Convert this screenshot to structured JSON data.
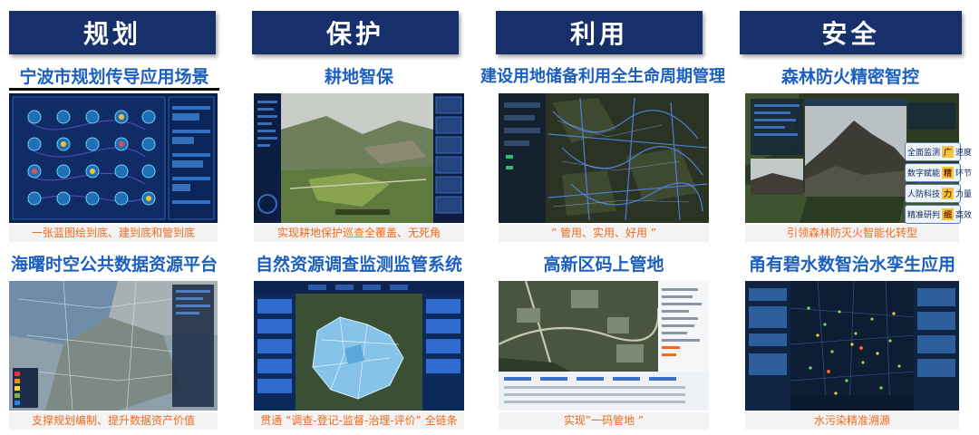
{
  "categories": [
    {
      "label": "规划"
    },
    {
      "label": "保护"
    },
    {
      "label": "利用"
    },
    {
      "label": "安全"
    }
  ],
  "cards": [
    {
      "title": "宁波市规划传导应用场景",
      "caption": "一张蓝图绘到底、建到底和管到底",
      "shot": "planning-dashboard"
    },
    {
      "title": "耕地智保",
      "caption": "实现耕地保护巡查全覆盖、无死角",
      "shot": "farmland-monitoring"
    },
    {
      "title": "建设用地储备利用全生命周期管理",
      "caption": "” 管用、实用、好用 ”",
      "shot": "land-reserve-map"
    },
    {
      "title": "森林防火精密智控",
      "caption": "引领森林防灭火智能化转型",
      "shot": "forest-fire-control"
    },
    {
      "title": "海曙时空公共数据资源平台",
      "caption": "支撑规划编制、提升数据资产价值",
      "shot": "spatiotemporal-data-map"
    },
    {
      "title": "自然资源调查监测监管系统",
      "caption": "贯通 “调查-登记-监督-治理-评价” 全链条",
      "shot": "resource-monitoring-3d"
    },
    {
      "title": "高新区码上管地",
      "caption": "实现”一码管地 ”",
      "shot": "land-code-management"
    },
    {
      "title": "甬有碧水数智治水孪生应用",
      "caption": "水污染精准溯源",
      "shot": "water-pollution-map"
    }
  ],
  "fire_panel": {
    "rows": [
      {
        "left": "全面监测",
        "badge": "广",
        "right": "速度"
      },
      {
        "left": "数字赋能",
        "badge": "精",
        "right": "环节"
      },
      {
        "left": "人防科技",
        "badge": "力",
        "right": "力量"
      },
      {
        "left": "精准研判",
        "badge": "细",
        "right": "高效"
      }
    ]
  },
  "colors": {
    "header_bg": "#17306b",
    "title_text": "#1d5fbf",
    "caption_text": "#f26a1b",
    "caption_bg": "#f3f3f3"
  }
}
